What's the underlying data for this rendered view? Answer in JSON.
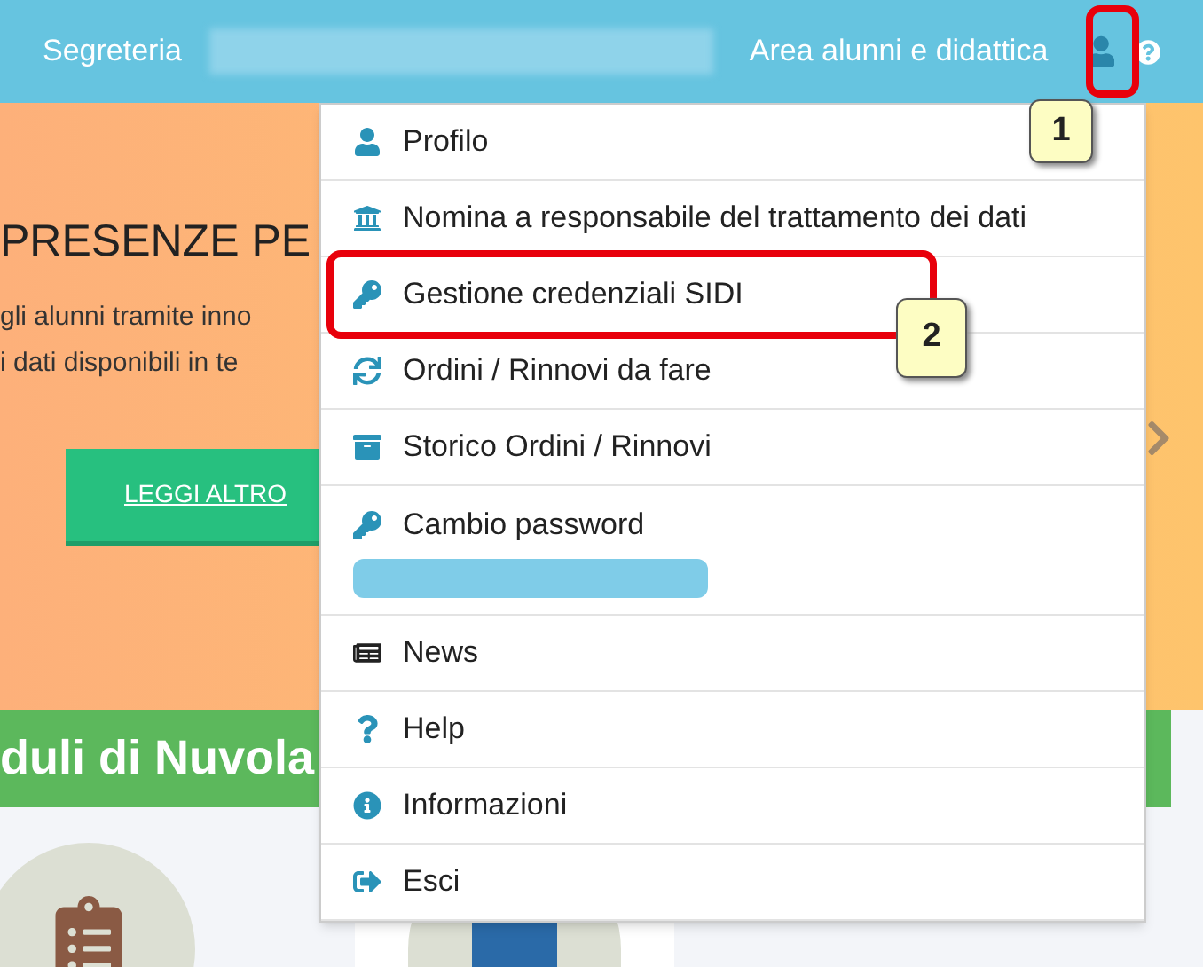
{
  "header": {
    "left_label": "Segreteria",
    "right_label": "Area alunni e didattica"
  },
  "hero": {
    "title": "PRESENZE PE",
    "lines": [
      "gli alunni tramite inno",
      "i dati disponibili in te"
    ],
    "button": "LEGGI ALTRO"
  },
  "section": {
    "title": "duli di Nuvola"
  },
  "menu": {
    "items": [
      {
        "label": "Profilo",
        "kind": "user"
      },
      {
        "label": "Nomina a responsabile del trattamento dei dati",
        "kind": "building"
      },
      {
        "label": "Gestione credenziali SIDI",
        "kind": "key"
      },
      {
        "label": "Ordini / Rinnovi da fare",
        "kind": "sync"
      },
      {
        "label": "Storico Ordini / Rinnovi",
        "kind": "archive"
      },
      {
        "label": "Cambio password",
        "kind": "password"
      },
      {
        "label": "News",
        "kind": "news"
      },
      {
        "label": "Help",
        "kind": "help"
      },
      {
        "label": "Informazioni",
        "kind": "info"
      },
      {
        "label": "Esci",
        "kind": "logout"
      }
    ]
  },
  "callouts": [
    {
      "label": "1"
    },
    {
      "label": "2"
    }
  ]
}
